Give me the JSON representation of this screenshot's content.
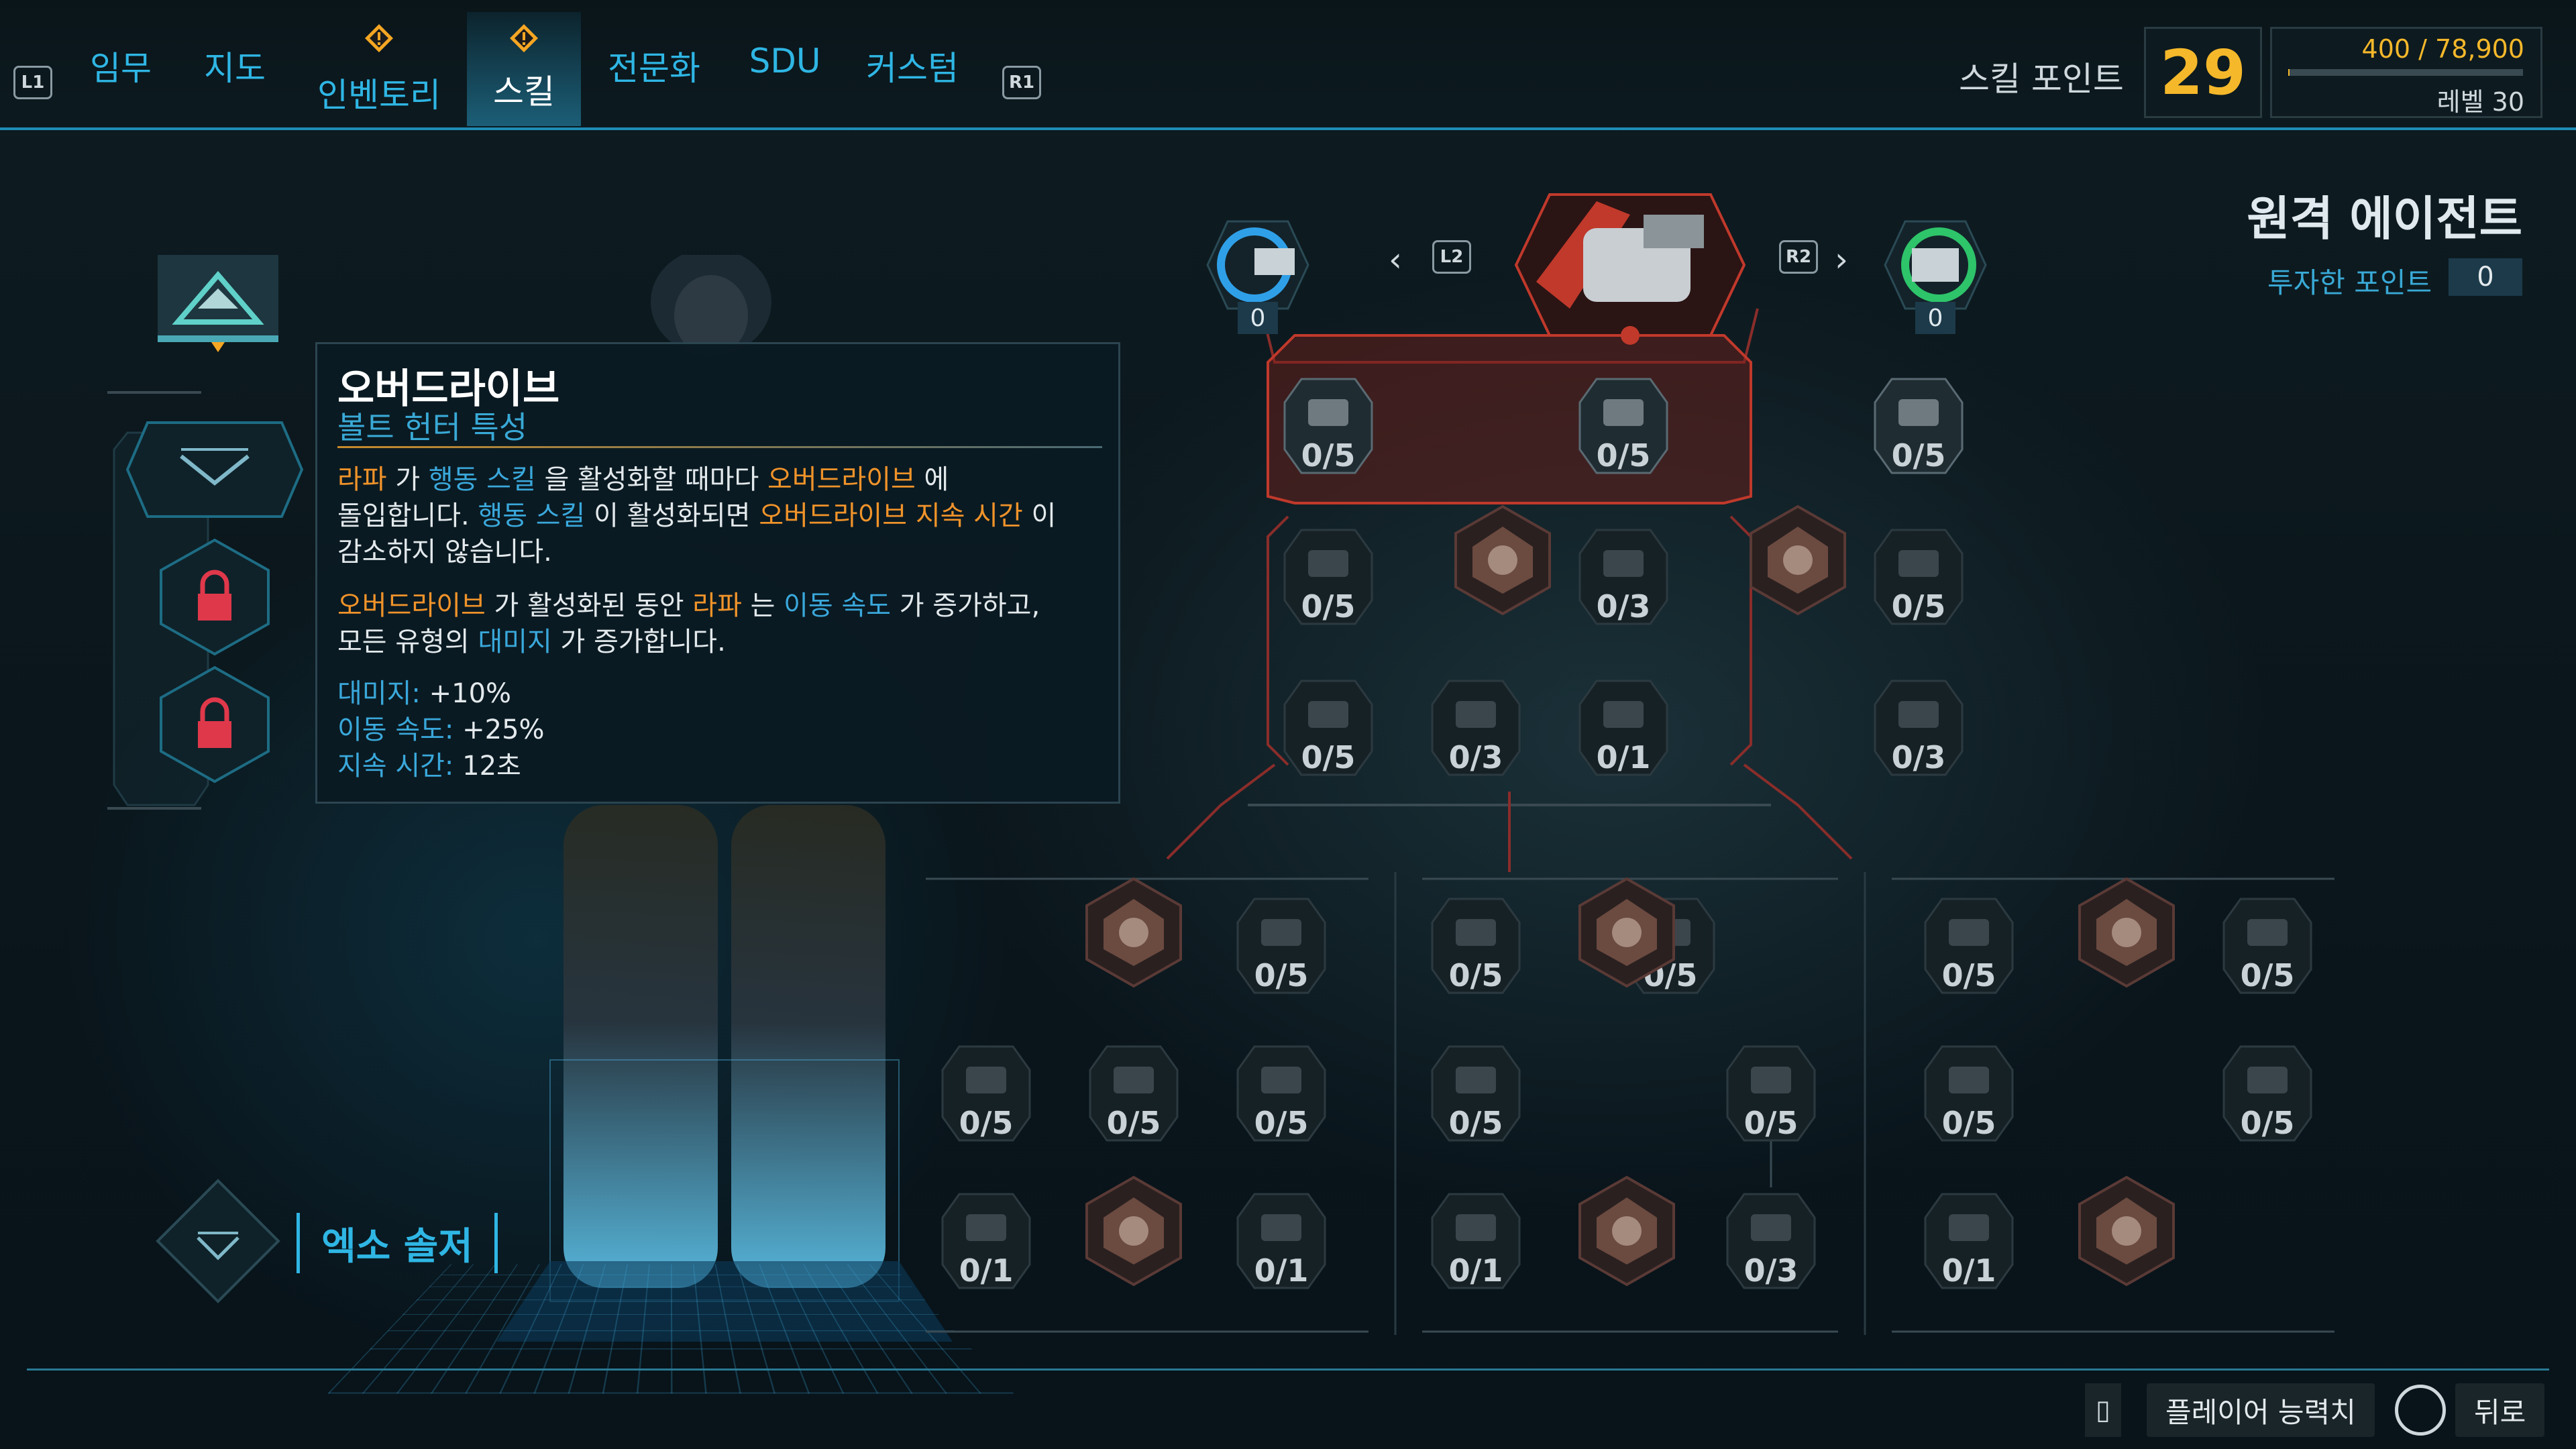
{
  "top_nav": {
    "left_hint": "L1",
    "right_hint": "R1",
    "tabs": [
      "임무",
      "지도",
      "인벤토리",
      "스킬",
      "전문화",
      "SDU",
      "커스텀"
    ],
    "active_tab": "스킬",
    "skill_points_label": "스킬 포인트",
    "skill_points": "29",
    "xp_text": "400 / 78,900",
    "xp_progress": 0.005,
    "level_text": "레벨 30"
  },
  "left_panel": {
    "class_name": "엑소 솔저"
  },
  "tooltip": {
    "title": "오버드라이브",
    "subtitle": "볼트 헌터 특성",
    "p1_a": "라파",
    "p1_b": " 가 ",
    "p1_c": "행동 스킬",
    "p1_d": " 을 활성화할 때마다 ",
    "p1_e": "오버드라이브",
    "p1_f": " 에",
    "p1_g": "돌입합니다. ",
    "p1_h": "행동 스킬",
    "p1_i": " 이 활성화되면 ",
    "p1_j": "오버드라이브 지속 시간",
    "p1_k": " 이",
    "p1_l": "감소하지 않습니다.",
    "p2_a": "오버드라이브",
    "p2_b": " 가 활성화된 동안 ",
    "p2_c": "라파",
    "p2_d": " 는 ",
    "p2_e": "이동 속도",
    "p2_f": " 가 증가하고,",
    "p2_g": "모든 유형의 ",
    "p2_h": "대미지",
    "p2_i": " 가 증가합니다.",
    "stat1_label": "대미지:",
    "stat1_value": " +10%",
    "stat2_label": "이동 속도:",
    "stat2_value": " +25%",
    "stat3_label": "지속 시간:",
    "stat3_value": " 12초"
  },
  "tree_header": {
    "title": "원격 에이전트",
    "invested_label": "투자한 포인트",
    "invested_value": "0",
    "prev_hint": "L2",
    "next_hint": "R2",
    "left_spec_points": "0",
    "right_spec_points": "0"
  },
  "skill_nodes": [
    {
      "id": "r1c1",
      "count": "0/5"
    },
    {
      "id": "r1c2",
      "count": "0/5"
    },
    {
      "id": "r1c3",
      "count": "0/5"
    },
    {
      "id": "r2c1",
      "count": "0/5"
    },
    {
      "id": "r2c3",
      "count": "0/3"
    },
    {
      "id": "r2c5",
      "count": "0/5"
    },
    {
      "id": "r3c1",
      "count": "0/5"
    },
    {
      "id": "r3c2",
      "count": "0/3"
    },
    {
      "id": "r3c3",
      "count": "0/1"
    },
    {
      "id": "r3c5",
      "count": "0/3"
    },
    {
      "id": "b1c2",
      "count": "0/5"
    },
    {
      "id": "b1c3",
      "count": "0/5"
    },
    {
      "id": "b1c5",
      "count": "0/5"
    },
    {
      "id": "b1c6",
      "count": "0/5"
    },
    {
      "id": "b1c8",
      "count": "0/5"
    },
    {
      "id": "b2c1",
      "count": "0/5"
    },
    {
      "id": "b2c2",
      "count": "0/5"
    },
    {
      "id": "b2c3",
      "count": "0/5"
    },
    {
      "id": "b2c4",
      "count": "0/5"
    },
    {
      "id": "b2c6",
      "count": "0/5"
    },
    {
      "id": "b2c7",
      "count": "0/5"
    },
    {
      "id": "b2c9",
      "count": "0/5"
    },
    {
      "id": "b3c1",
      "count": "0/1"
    },
    {
      "id": "b3c3",
      "count": "0/1"
    },
    {
      "id": "b3c4",
      "count": "0/1"
    },
    {
      "id": "b3c6",
      "count": "0/3"
    },
    {
      "id": "b3c7",
      "count": "0/1"
    }
  ],
  "bottom_bar": {
    "player_stats_label": "플레이어 능력치",
    "back_label": "뒤로"
  },
  "colors": {
    "accent_blue": "#2fb6e4",
    "skill_points_gold": "#f5b82b",
    "tree_red": "#c0392b",
    "highlight_orange": "#f0932a"
  }
}
